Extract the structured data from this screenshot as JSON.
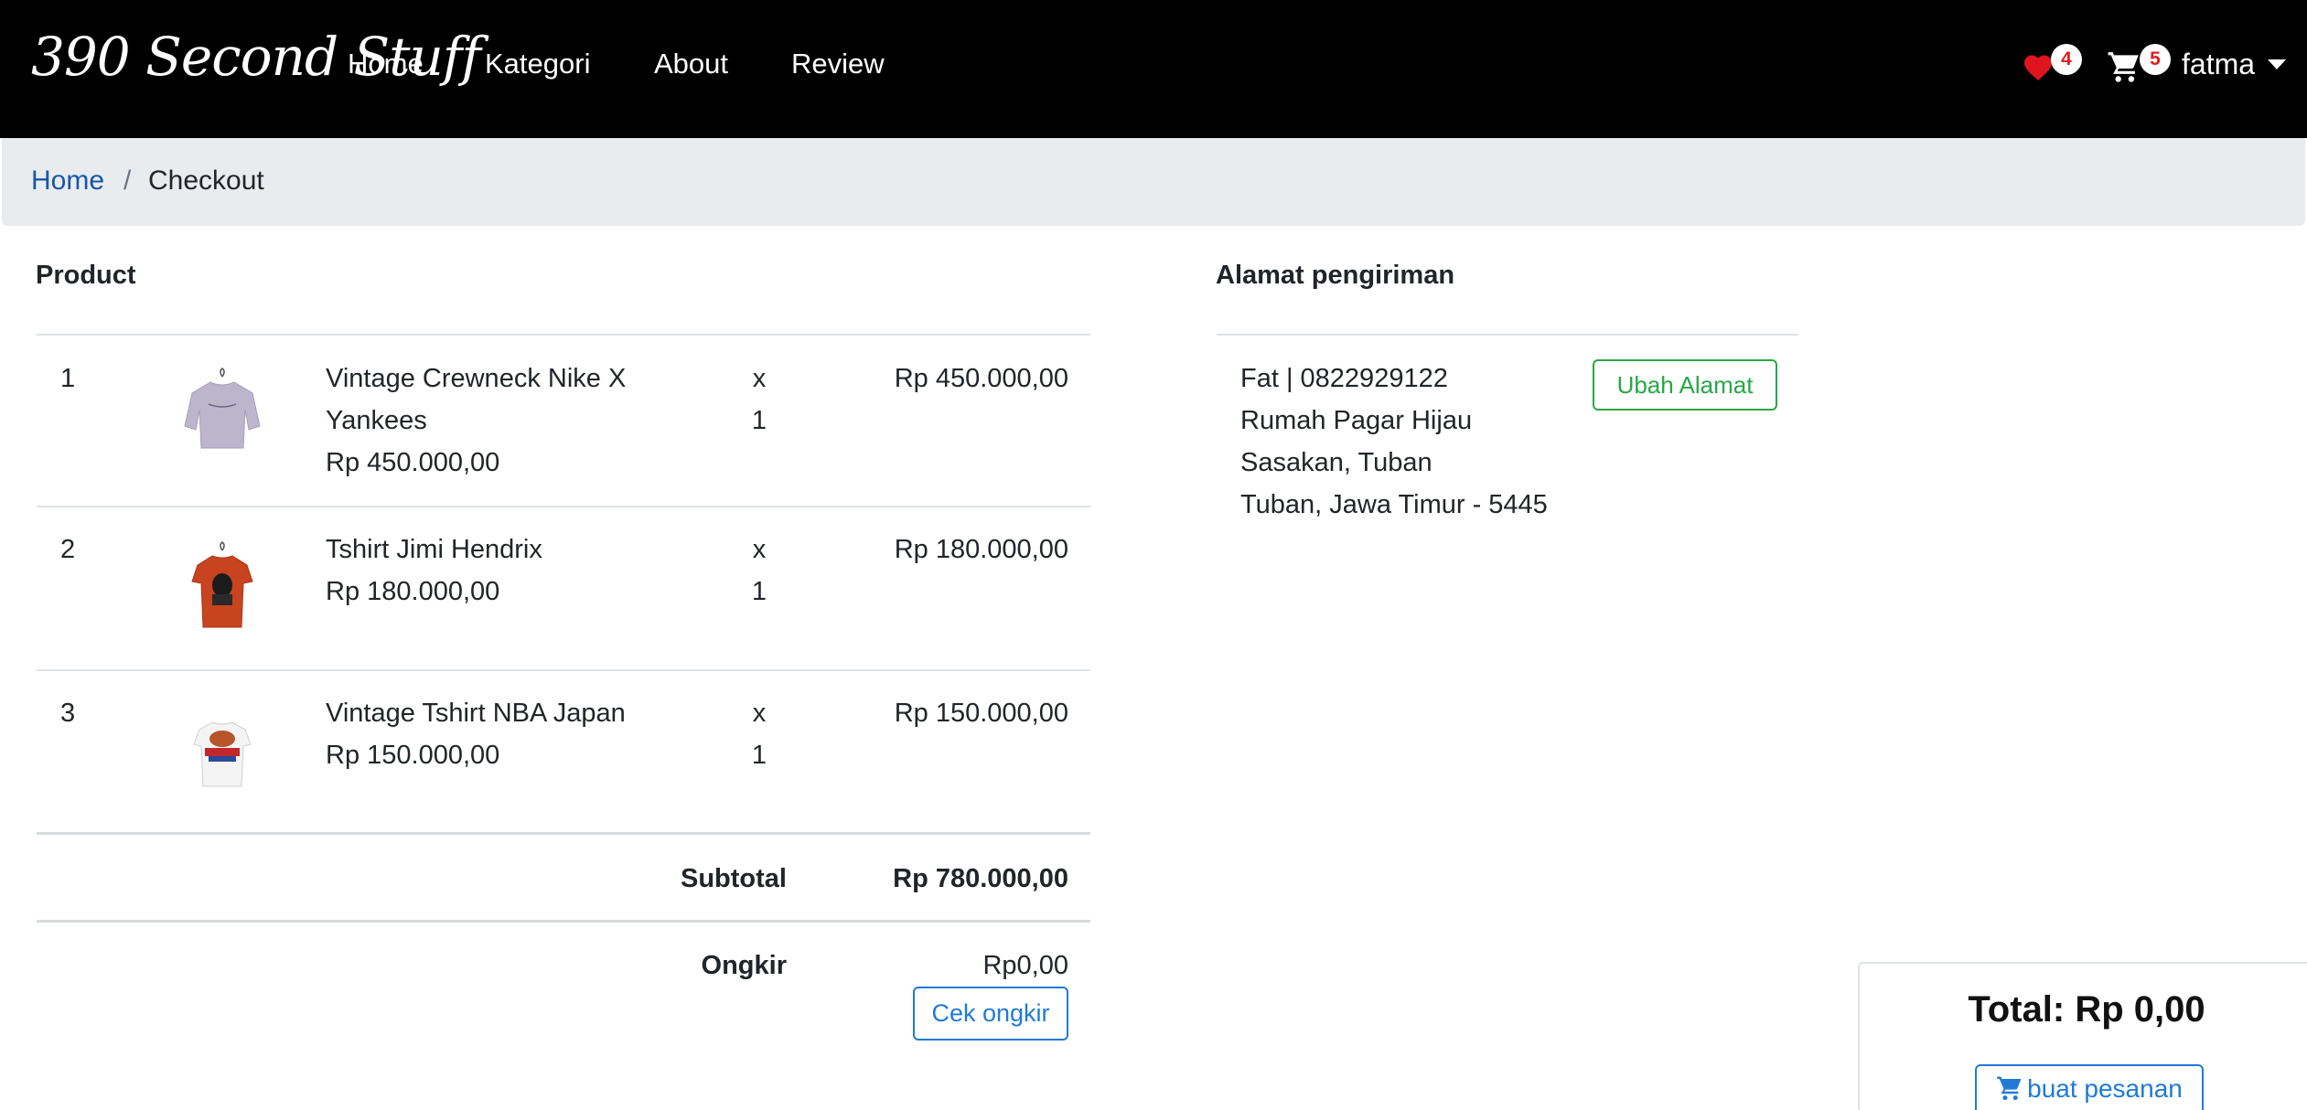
{
  "navbar": {
    "brand": "390 Second Stuff",
    "links": [
      "Home",
      "Kategori",
      "About",
      "Review"
    ],
    "wishlist_count": "4",
    "cart_count": "5",
    "user": "fatma"
  },
  "breadcrumb": {
    "home": "Home",
    "separator": "/",
    "current": "Checkout"
  },
  "product_section": {
    "heading": "Product",
    "items": [
      {
        "no": "1",
        "name_line1": "Vintage Crewneck Nike X",
        "name_line2": "Yankees",
        "unit_price": "Rp 450.000,00",
        "x": "x",
        "qty": "1",
        "line_total": "Rp 450.000,00"
      },
      {
        "no": "2",
        "name_line1": "Tshirt Jimi Hendrix",
        "unit_price": "Rp 180.000,00",
        "x": "x",
        "qty": "1",
        "line_total": "Rp 180.000,00"
      },
      {
        "no": "3",
        "name_line1": "Vintage Tshirt NBA Japan",
        "unit_price": "Rp 150.000,00",
        "x": "x",
        "qty": "1",
        "line_total": "Rp 150.000,00"
      }
    ],
    "subtotal_label": "Subtotal",
    "subtotal_value": "Rp 780.000,00",
    "ongkir_label": "Ongkir",
    "ongkir_value": "Rp0,00",
    "cek_ongkir_label": "Cek ongkir"
  },
  "shipping": {
    "heading": "Alamat pengiriman",
    "lines": [
      "Fat | 0822929122",
      "Rumah Pagar Hijau",
      "Sasakan, Tuban",
      "Tuban, Jawa Timur - 5445"
    ],
    "change_label": "Ubah Alamat"
  },
  "summary": {
    "total": "Total: Rp 0,00",
    "order_label": "buat pesanan"
  },
  "colors": {
    "navbar_bg": "#000000",
    "badge_text": "#e01e1e",
    "heart": "#e0141e",
    "link_primary": "#1f7ad6",
    "success": "#28a745",
    "breadcrumb_bg": "#e9ecef"
  }
}
